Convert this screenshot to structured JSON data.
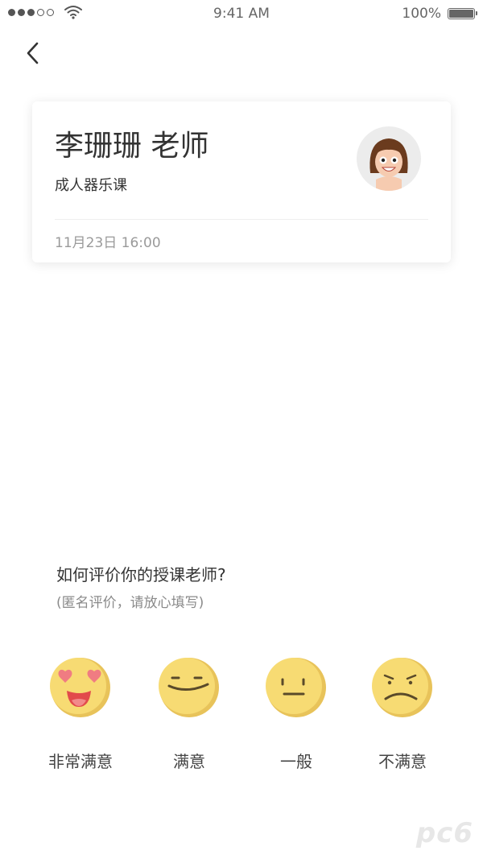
{
  "status_bar": {
    "time": "9:41 AM",
    "battery": "100%",
    "signal_icon": "signal-dots-icon",
    "wifi_icon": "wifi-icon",
    "battery_icon": "battery-icon"
  },
  "nav": {
    "back_icon": "chevron-left-icon"
  },
  "teacher": {
    "name": "李珊珊 老师",
    "course": "成人器乐课",
    "datetime": "11月23日 16:00",
    "avatar_icon": "teacher-avatar-icon"
  },
  "rating": {
    "question": "如何评价你的授课老师?",
    "hint": "(匿名评价，请放心填写)",
    "options": [
      {
        "label": "非常满意",
        "icon": "heart-eyes-emoji-icon"
      },
      {
        "label": "满意",
        "icon": "smile-emoji-icon"
      },
      {
        "label": "一般",
        "icon": "neutral-emoji-icon"
      },
      {
        "label": "不满意",
        "icon": "frown-emoji-icon"
      }
    ]
  },
  "colors": {
    "emoji_face": "#F7DB73",
    "emoji_shade": "#E8C35A",
    "heart": "#F07C82",
    "text_primary": "#333333",
    "text_secondary": "#9A9A9A"
  }
}
